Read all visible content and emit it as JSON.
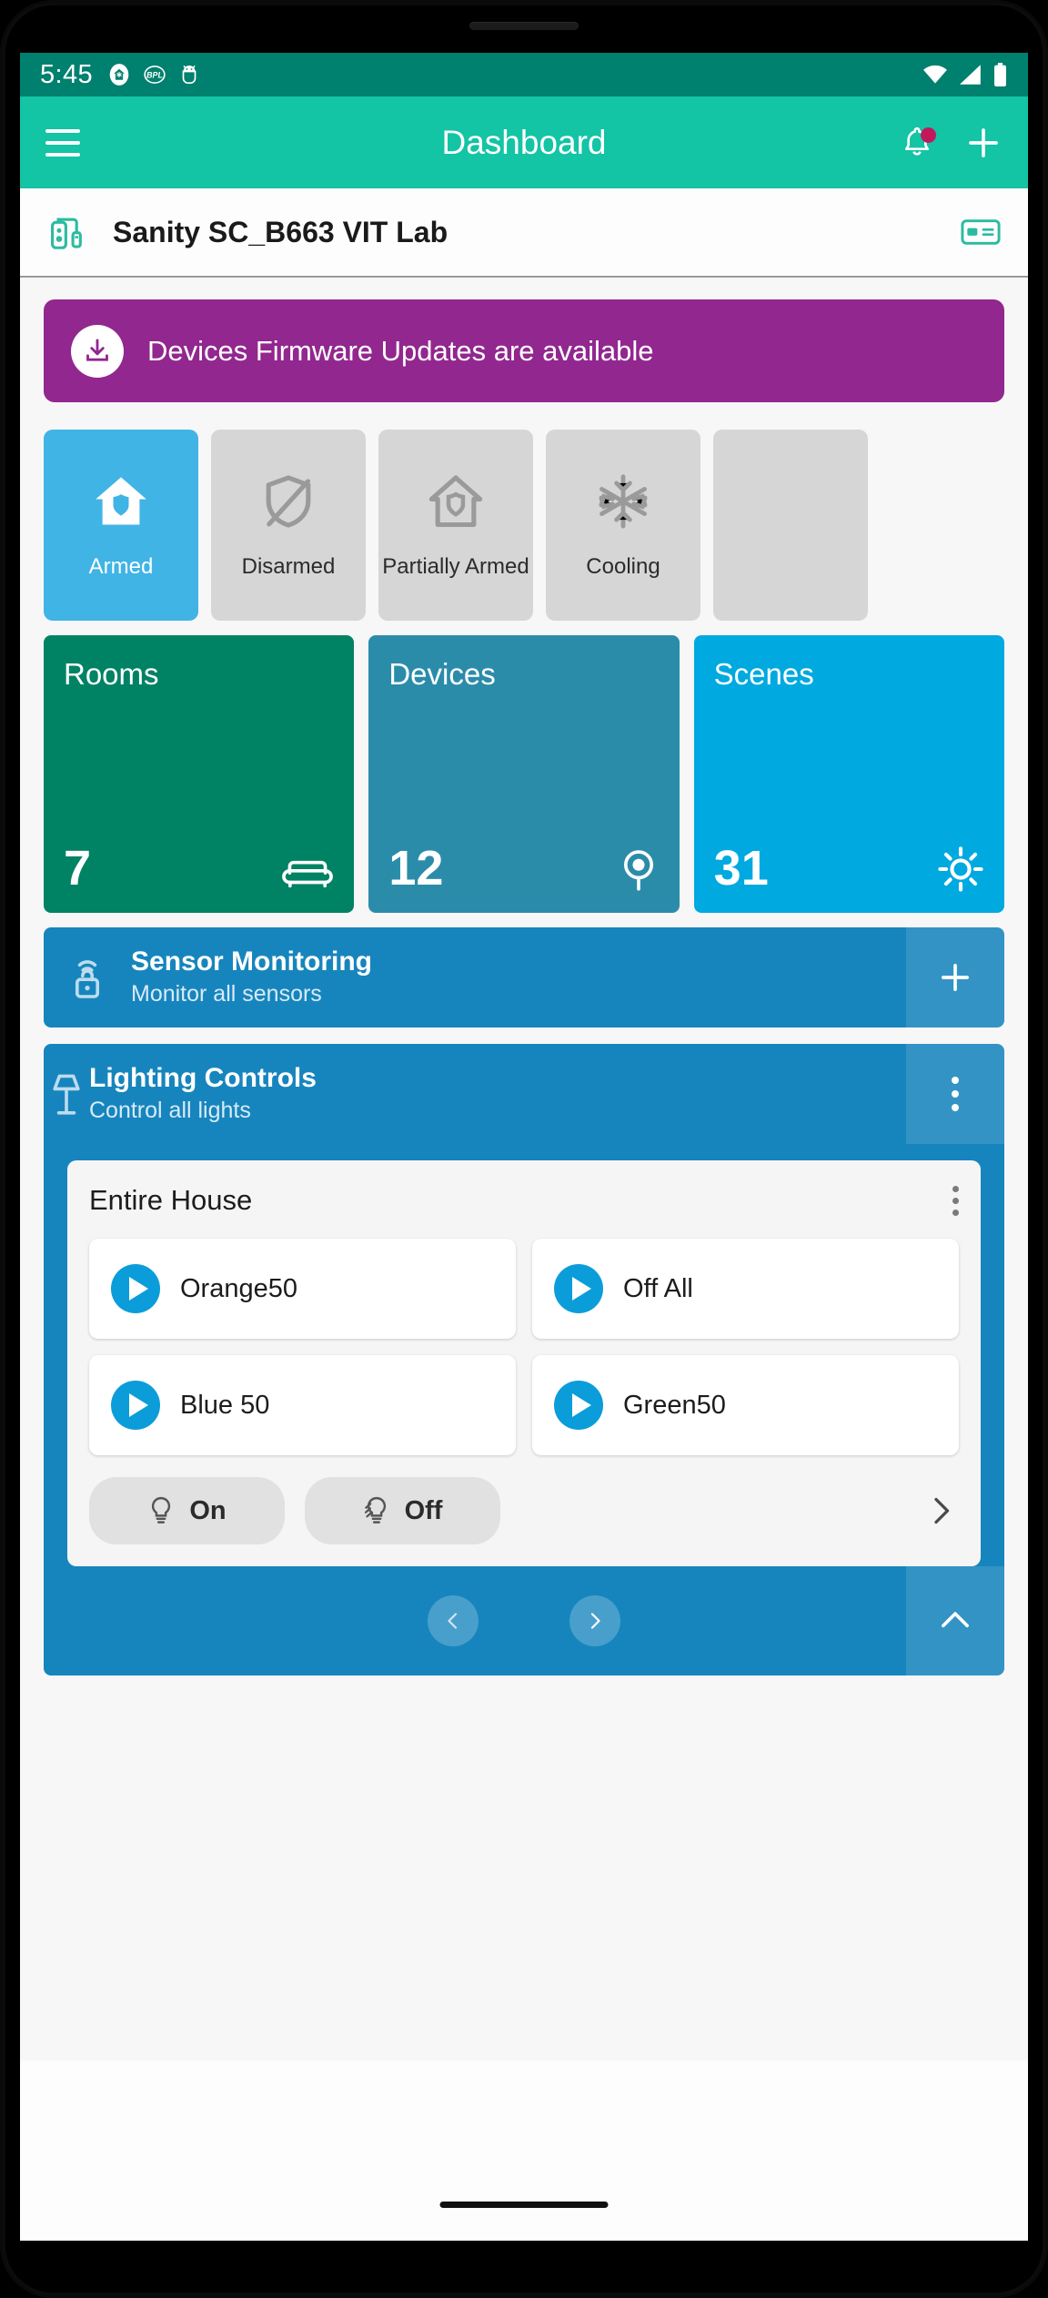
{
  "status_bar": {
    "time": "5:45",
    "left_icons": [
      "smart-home-app-icon",
      "bpl-icon",
      "android-debug-icon"
    ],
    "right_icons": [
      "wifi-icon",
      "cellular-signal-icon",
      "battery-full-icon"
    ]
  },
  "app_bar": {
    "title": "Dashboard",
    "menu_icon": "hamburger-menu-icon",
    "notification_icon": "bell-icon",
    "add_icon": "plus-icon",
    "has_notification_badge": true,
    "bg_color": "#13C4A5",
    "badge_color": "#C2185B"
  },
  "site_header": {
    "name": "Sanity SC_B663 VIT Lab",
    "left_icon": "controller-device-icon",
    "right_icon": "keypad-card-icon",
    "icon_color": "#2BBBA0"
  },
  "firmware_banner": {
    "text": "Devices Firmware Updates are available",
    "icon": "download-icon",
    "color": "#92278F"
  },
  "mode_chips": {
    "active_color": "#40B4E5",
    "inactive_color": "#D6D6D6",
    "items": [
      {
        "label": "Armed",
        "icon": "home-shield-icon",
        "active": true
      },
      {
        "label": "Disarmed",
        "icon": "shield-off-icon",
        "active": false
      },
      {
        "label": "Partially Armed",
        "icon": "home-partial-shield-icon",
        "active": false
      },
      {
        "label": "Cooling",
        "icon": "snowflake-icon",
        "active": false
      },
      {
        "label": "",
        "icon": "",
        "active": false
      }
    ]
  },
  "tiles": [
    {
      "title": "Rooms",
      "count": "7",
      "icon": "sofa-icon",
      "color": "#008264"
    },
    {
      "title": "Devices",
      "count": "12",
      "icon": "bulb-pin-icon",
      "color": "#2B8CAA"
    },
    {
      "title": "Scenes",
      "count": "31",
      "icon": "brightness-icon",
      "color": "#00A9E0"
    }
  ],
  "sensor_monitoring": {
    "title": "Sensor Monitoring",
    "subtitle": "Monitor all sensors",
    "icon": "sensor-lock-icon",
    "action_icon": "plus-icon",
    "color": "#1785BD"
  },
  "lighting_controls": {
    "title": "Lighting Controls",
    "subtitle": "Control all lights",
    "icon": "lamp-icon",
    "action_icon": "kebab-menu-icon",
    "color": "#1785BD",
    "card": {
      "title": "Entire House",
      "kebab_icon": "kebab-menu-icon",
      "scenes": [
        {
          "name": "Orange50",
          "icon": "play-icon"
        },
        {
          "name": "Off All",
          "icon": "play-icon"
        },
        {
          "name": "Blue 50",
          "icon": "play-icon"
        },
        {
          "name": "Green50",
          "icon": "play-icon"
        }
      ],
      "on_label": "On",
      "on_icon": "bulb-on-icon",
      "off_label": "Off",
      "off_icon": "bulb-off-icon",
      "next_icon": "chevron-right-icon"
    },
    "pager": {
      "prev_icon": "chevron-left-icon",
      "next_icon": "chevron-right-icon",
      "collapse_icon": "chevron-up-icon"
    }
  }
}
